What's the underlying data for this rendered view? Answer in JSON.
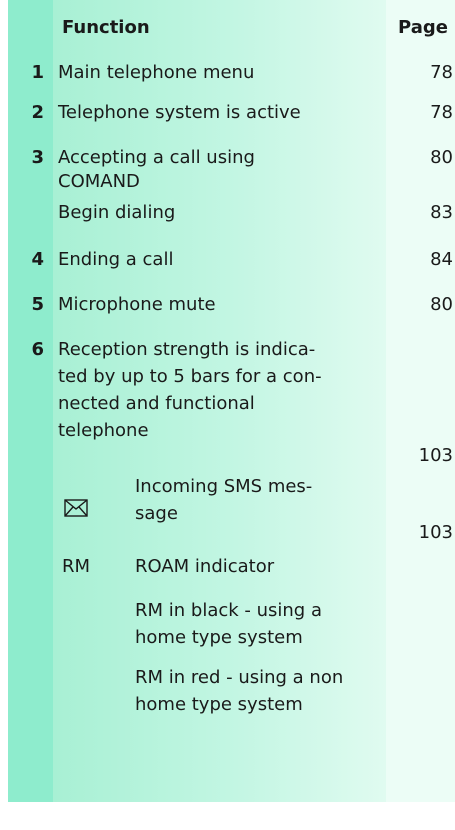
{
  "header": {
    "function": "Function",
    "page": "Page"
  },
  "rows": [
    {
      "number": "1",
      "lines": [
        "Main telephone menu"
      ],
      "page": "78"
    },
    {
      "number": "2",
      "lines": [
        "Telephone system is active"
      ],
      "page": "78"
    },
    {
      "number": "3",
      "lines": [
        "Accepting a call using",
        "COMAND"
      ],
      "page": "80"
    },
    {
      "number": "",
      "lines": [
        "Begin dialing"
      ],
      "page": "83"
    },
    {
      "number": "4",
      "lines": [
        "Ending a call"
      ],
      "page": "84"
    },
    {
      "number": "5",
      "lines": [
        "Microphone mute"
      ],
      "page": "80"
    },
    {
      "number": "6",
      "lines": [
        "Reception strength is indica-",
        "ted by up to 5 bars for a con-",
        "nected and functional",
        "telephone"
      ],
      "page": "103"
    }
  ],
  "sub_rows": [
    {
      "icon": "envelope-icon",
      "lines": [
        "Incoming SMS mes-",
        "sage"
      ],
      "page": "103"
    },
    {
      "label": "RM",
      "lines": [
        "ROAM indicator"
      ]
    },
    {
      "lines": [
        "RM in black - using a",
        "home type system"
      ]
    },
    {
      "lines": [
        "RM in red - using a non",
        "home type system"
      ]
    }
  ]
}
